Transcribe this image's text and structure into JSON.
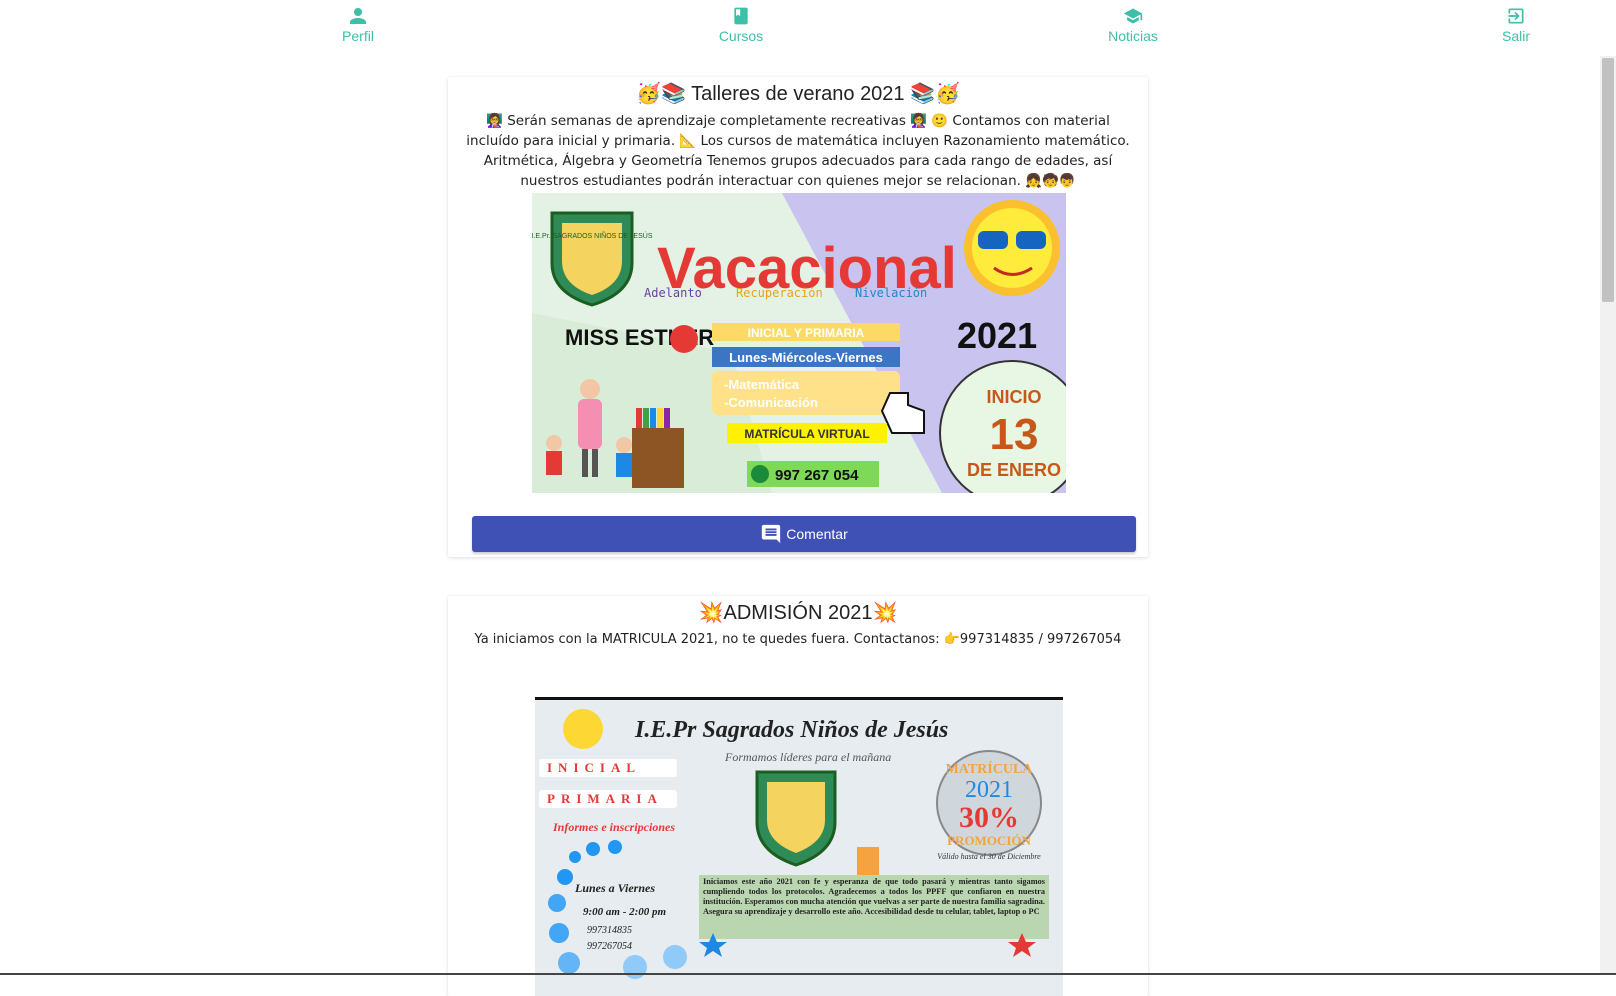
{
  "nav": {
    "items": [
      {
        "label": "Perfil",
        "icon": "person-icon"
      },
      {
        "label": "Cursos",
        "icon": "book-icon"
      },
      {
        "label": "Noticias",
        "icon": "graduation-cap-icon"
      },
      {
        "label": "Salir",
        "icon": "exit-icon"
      }
    ],
    "accent_color": "#3fbfa8"
  },
  "posts": [
    {
      "title": "🥳📚 Talleres de verano 2021 📚🥳",
      "body": "👩‍🏫 Serán semanas de aprendizaje completamente recreativas 👩‍🏫 🙂 Contamos con material incluído para inicial y primaria. 📐 Los cursos de matemática incluyen Razonamiento matemático. Aritmética, Álgebra y Geometría Tenemos grupos adecuados para cada rango de edades, así nuestros estudiantes podrán interactuar con quienes mejor se relacionan. 👧🧒👦",
      "image": {
        "heading": "Vacacional",
        "tags": [
          "Adelanto",
          "Recuperación",
          "Nivelación"
        ],
        "teacher": "MISS ESTHER",
        "level": "INICIAL Y PRIMARIA",
        "days": "Lunes-Miércoles-Viernes",
        "subjects": [
          "-Matemática",
          "-Comunicación"
        ],
        "enrollment": "MATRÍCULA VIRTUAL",
        "phone": "997 267 054",
        "year": "2021",
        "start_label": "INICIO",
        "start_day": "13",
        "start_month": "DE ENERO",
        "school_short": "I.E.Pr. SAGRADOS NIÑOS DE JESÚS"
      },
      "button_label": "Comentar",
      "button_color": "#3f51b5"
    },
    {
      "title": "💥ADMISIÓN 2021💥",
      "body": "Ya iniciamos con la MATRICULA 2021, no te quedes fuera. Contactanos: 👉997314835 / 997267054",
      "image": {
        "school": "I.E.Pr Sagrados Niños de Jesús",
        "motto": "Formamos líderes para el mañana",
        "levels": [
          "INICIAL",
          "PRIMARIA"
        ],
        "info_label": "Informes e inscripciones",
        "days": "Lunes a Viernes",
        "hours": "9:00 am - 2:00 pm",
        "phones": [
          "997314835",
          "997267054"
        ],
        "promo_top": "MATRÍCULA",
        "promo_year": "2021",
        "promo_pct": "30%",
        "promo_label": "PROMOCIÓN",
        "promo_valid": "Válido hasta el 30 de Diciembre",
        "paragraph": "Iniciamos este año 2021 con fe y esperanza de que todo pasará y mientras tanto sigamos cumpliendo todos los protocolos. Agradecemos a todos los PPFF que confiaron en nuestra institución. Esperamos con mucha atención que vuelvas a ser parte de nuestra familia sagradina. Asegura su aprendizaje y desarrollo este año. Accesibilidad desde tu celular, tablet, laptop o PC"
      }
    }
  ]
}
